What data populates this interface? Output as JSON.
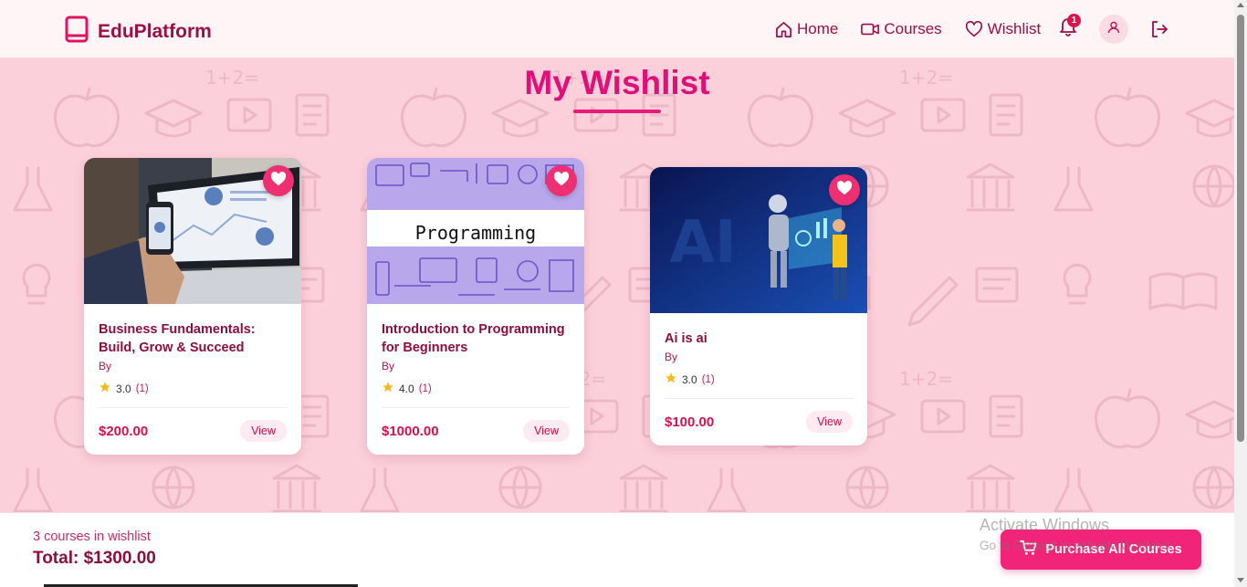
{
  "app": {
    "brand": "EduPlatform"
  },
  "nav": {
    "items": [
      {
        "label": "Home",
        "icon": "home-icon"
      },
      {
        "label": "Courses",
        "icon": "video-icon"
      },
      {
        "label": "Wishlist",
        "icon": "heart-icon"
      }
    ],
    "notification_count": "1"
  },
  "page": {
    "title": "My Wishlist"
  },
  "courses": [
    {
      "title": "Business Fundamentals: Build, Grow & Succeed",
      "by": "By",
      "rating": "3.0",
      "rating_count": "(1)",
      "price": "$200.00",
      "view_label": "View",
      "image_text": ""
    },
    {
      "title": "Introduction to Programming for Beginners",
      "by": "By",
      "rating": "4.0",
      "rating_count": "(1)",
      "price": "$1000.00",
      "view_label": "View",
      "image_text": "Programming"
    },
    {
      "title": "Ai is ai",
      "by": "By",
      "rating": "3.0",
      "rating_count": "(1)",
      "price": "$100.00",
      "view_label": "View",
      "image_text": "AI"
    }
  ],
  "summary": {
    "count_text": "3 courses in wishlist",
    "total_text": "Total: $1300.00",
    "purchase_label": "Purchase All Courses"
  },
  "watermark": {
    "line1": "Activate Windows",
    "line2": "Go to Settings to activate Windows."
  },
  "colors": {
    "accent": "#e0107a",
    "brand": "#9a0f45",
    "background": "#fbd0da"
  }
}
